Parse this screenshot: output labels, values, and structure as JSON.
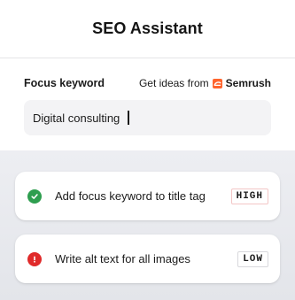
{
  "header": {
    "title": "SEO Assistant"
  },
  "keyword": {
    "label": "Focus keyword",
    "ideas_prefix": "Get ideas from",
    "ideas_brand": "Semrush",
    "input_value": "Digital consulting"
  },
  "checks": [
    {
      "status": "success",
      "status_icon": "check-circle-icon",
      "text": "Add focus keyword to title tag",
      "priority": "HIGH"
    },
    {
      "status": "error",
      "status_icon": "alert-circle-icon",
      "text": "Write alt text for all images",
      "priority": "LOW"
    }
  ],
  "colors": {
    "success": "#2e9e4f",
    "error": "#e02a2a",
    "semrush": "#ff642d"
  }
}
